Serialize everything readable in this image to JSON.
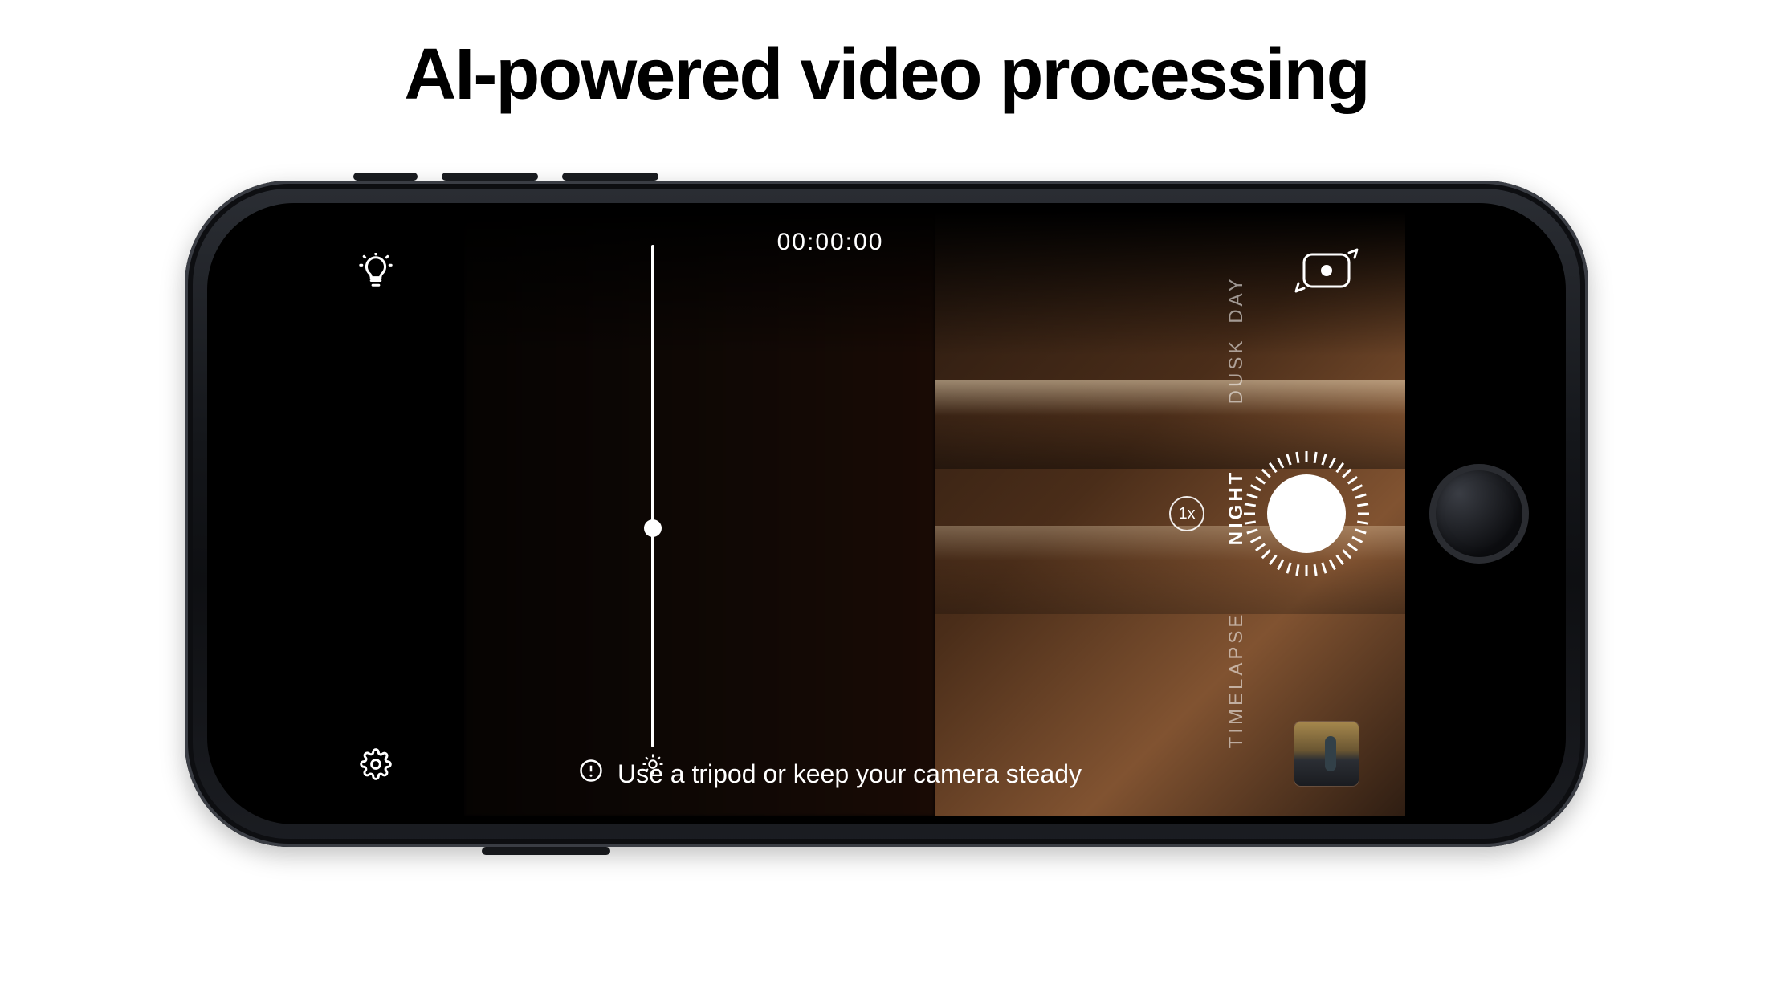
{
  "headline": "AI-powered video processing",
  "camera": {
    "timer": "00:00:00",
    "zoom_label": "1x",
    "modes": {
      "day": "DAY",
      "dusk": "DUSK",
      "night": "NIGHT",
      "timelapse": "TIMELAPSE",
      "active": "NIGHT"
    },
    "exposure_slider_value": 0.53,
    "tip": "Use a tripod or keep your camera steady"
  }
}
